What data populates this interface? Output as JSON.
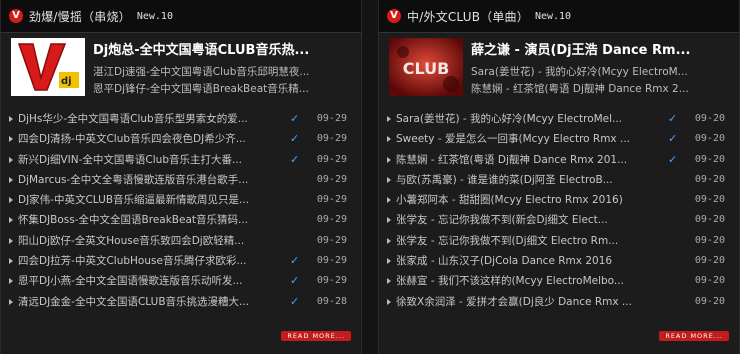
{
  "panels": [
    {
      "header": {
        "title": "劲爆/慢摇（串烧）",
        "new": "New.10"
      },
      "thumb": "v-dj-logo",
      "featured": {
        "title": "Dj炮总-全中文国粤语CLUB音乐热...",
        "lines": [
          "湛江Dj速强-全中文国粤语Club音乐邱明慧夜...",
          "恩平Dj锋仔-全中文国粤语BreakBeat音乐精..."
        ]
      },
      "items": [
        {
          "title": "DjHs华少-全中文国粤语Club音乐型男索女的爱...",
          "check": true,
          "date": "09-29"
        },
        {
          "title": "四会DJ清扬-中英文Club音乐四会夜色DJ希少齐...",
          "check": true,
          "date": "09-29"
        },
        {
          "title": "新兴Dj细VIN-全中文国粤语Club音乐主打大番...",
          "check": true,
          "date": "09-29"
        },
        {
          "title": "DjMarcus-全中文全粤语慢歌连版音乐港台歌手...",
          "check": false,
          "date": "09-29"
        },
        {
          "title": "DJ家伟-中英文CLUB音乐缩逼最新情歌周见只是...",
          "check": false,
          "date": "09-29"
        },
        {
          "title": "怀集DJBoss-全中文全国语BreakBeat音乐猜码...",
          "check": false,
          "date": "09-29"
        },
        {
          "title": "阳山Dj欧仔-全英文House音乐致四会Dj欧轻精...",
          "check": false,
          "date": "09-29"
        },
        {
          "title": "四会DJ拉芳-中英文ClubHouse音乐腾仔求欧彩...",
          "check": true,
          "date": "09-29"
        },
        {
          "title": "恩平DJ小燕-全中文全国语慢歌连版音乐动听发...",
          "check": true,
          "date": "09-29"
        },
        {
          "title": "清远DJ金金-全中文全国语CLUB音乐挑选漫糟大...",
          "check": true,
          "date": "09-28"
        }
      ],
      "read_more": "READ MORE..."
    },
    {
      "header": {
        "title": "中/外文CLUB（单曲）",
        "new": "New.10"
      },
      "thumb": "club-photo",
      "featured": {
        "title": "薛之谦 - 演员(Dj王浩 Dance Rm...",
        "lines": [
          "Sara(姜世花) - 我的心好冷(Mcyy ElectroM...",
          "陈慧娴 - 红茶馆(粤语 Dj靓神 Dance Rmx 2..."
        ]
      },
      "items": [
        {
          "title": "Sara(姜世花) - 我的心好冷(Mcyy ElectroMel...",
          "check": true,
          "date": "09-20"
        },
        {
          "title": "Sweety - 爱是怎么一回事(Mcyy Electro Rmx ...",
          "check": true,
          "date": "09-20"
        },
        {
          "title": "陈慧娴 - 红茶馆(粤语 Dj靓神 Dance Rmx 201...",
          "check": true,
          "date": "09-20"
        },
        {
          "title": "与欧(苏禹豪) - 谁是谁的菜(Dj阿圣 ElectroB...",
          "check": false,
          "date": "09-20"
        },
        {
          "title": "小薯郑阿本 - 甜甜圈(Mcyy Electro Rmx 2016)",
          "check": false,
          "date": "09-20"
        },
        {
          "title": "张学友 - 忘记你我做不到(新会Dj细文 Elect...",
          "check": false,
          "date": "09-20"
        },
        {
          "title": "张学友 - 忘记你我做不到(Dj细文 Electro Rm...",
          "check": false,
          "date": "09-20"
        },
        {
          "title": "张家成 - 山东汉子(DjCola Dance Rmx 2016",
          "check": false,
          "date": "09-20"
        },
        {
          "title": "张赫宣 - 我们不该这样的(Mcyy ElectroMelbo...",
          "check": false,
          "date": "09-20"
        },
        {
          "title": "徐致X余润泽 - 爱拼才会赢(Dj良少 Dance Rmx ...",
          "check": false,
          "date": "09-20"
        }
      ],
      "read_more": "READ MORE..."
    }
  ],
  "colors": {
    "accent": "#c31c1c",
    "check": "#4aa3ff",
    "background": "#1c1c1c"
  }
}
